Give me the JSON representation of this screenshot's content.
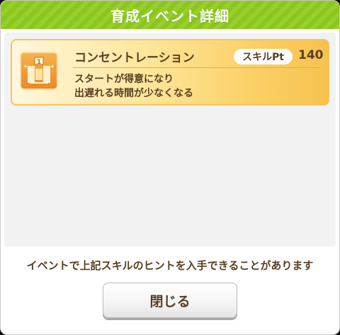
{
  "dialog": {
    "title": "育成イベント詳細",
    "header_color": "#97cf2b"
  },
  "skill": {
    "name": "コンセントレーション",
    "pt_label": "スキルPt",
    "pt_value": "140",
    "description": [
      "スタートが得意になり",
      "出遅れる時間が少なくなる"
    ],
    "icon": "gate-start-icon",
    "card_color": "#fbd168"
  },
  "hint": "イベントで上記スキルのヒントを入手できることがあります",
  "close_button": {
    "label": "閉じる"
  }
}
